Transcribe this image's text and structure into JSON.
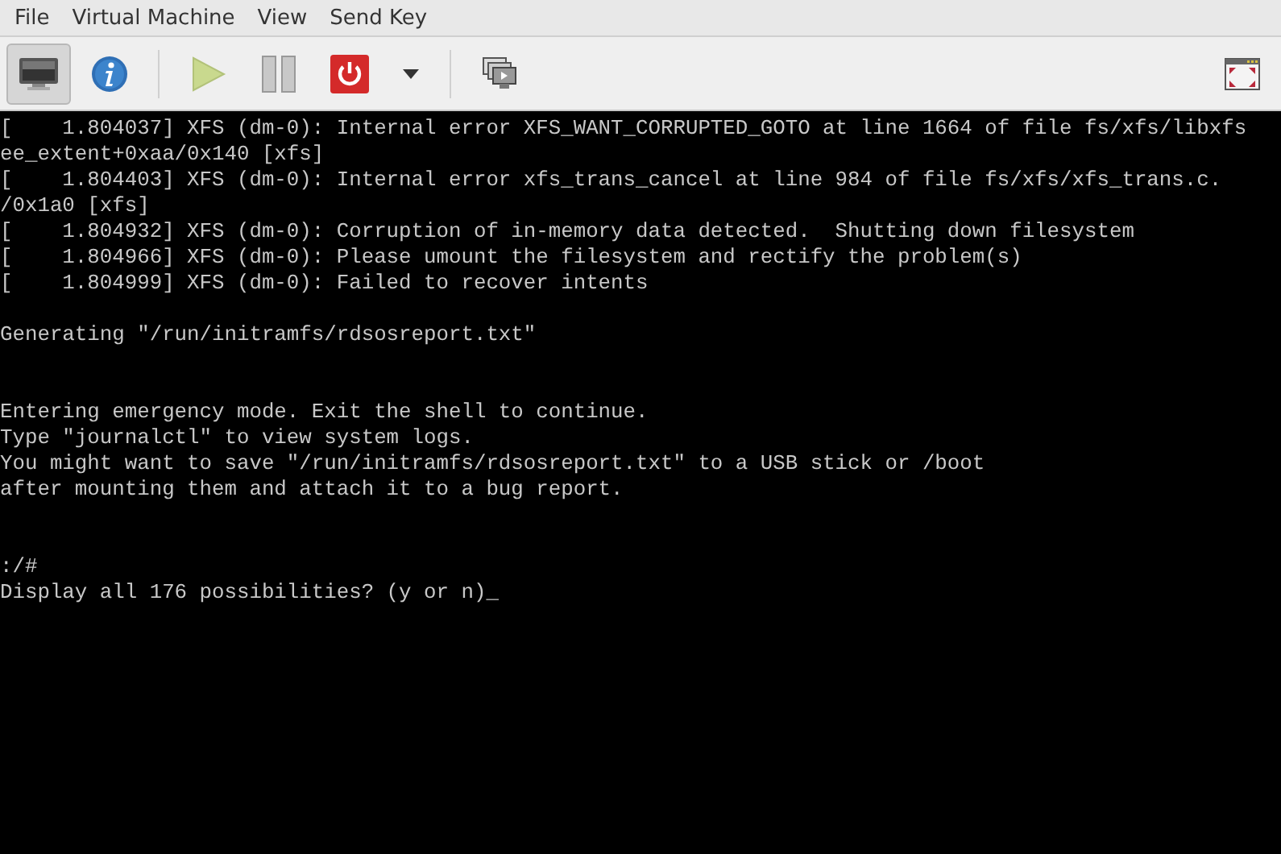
{
  "menu": [
    "File",
    "Virtual Machine",
    "View",
    "Send Key"
  ],
  "toolbar": [
    {
      "kind": "console",
      "selected": true
    },
    {
      "kind": "details",
      "selected": false
    },
    {
      "kind": "separator"
    },
    {
      "kind": "run",
      "selected": false
    },
    {
      "kind": "pause",
      "selected": false
    },
    {
      "kind": "shutdown",
      "selected": false
    },
    {
      "kind": "dropdown",
      "selected": false
    },
    {
      "kind": "separator"
    },
    {
      "kind": "screens",
      "selected": false
    },
    {
      "kind": "spacer"
    },
    {
      "kind": "fullscreen",
      "selected": false
    }
  ],
  "console": [
    {
      "kind": "text",
      "text": "[    1.804037] XFS (dm-0): Internal error XFS_WANT_CORRUPTED_GOTO at line 1664 of file fs/xfs/libxfs"
    },
    {
      "kind": "text",
      "text": "ee_extent+0xaa/0x140 [xfs]"
    },
    {
      "kind": "text",
      "text": "[    1.804403] XFS (dm-0): Internal error xfs_trans_cancel at line 984 of file fs/xfs/xfs_trans.c."
    },
    {
      "kind": "text",
      "text": "/0x1a0 [xfs]"
    },
    {
      "kind": "text",
      "text": "[    1.804932] XFS (dm-0): Corruption of in-memory data detected.  Shutting down filesystem"
    },
    {
      "kind": "text",
      "text": "[    1.804966] XFS (dm-0): Please umount the filesystem and rectify the problem(s)"
    },
    {
      "kind": "text",
      "text": "[    1.804999] XFS (dm-0): Failed to recover intents"
    },
    {
      "kind": "blank"
    },
    {
      "kind": "text",
      "text": "Generating \"/run/initramfs/rdsosreport.txt\""
    },
    {
      "kind": "blank"
    },
    {
      "kind": "blank"
    },
    {
      "kind": "text",
      "text": "Entering emergency mode. Exit the shell to continue."
    },
    {
      "kind": "text",
      "text": "Type \"journalctl\" to view system logs."
    },
    {
      "kind": "text",
      "text": "You might want to save \"/run/initramfs/rdsosreport.txt\" to a USB stick or /boot"
    },
    {
      "kind": "text",
      "text": "after mounting them and attach it to a bug report."
    },
    {
      "kind": "blank"
    },
    {
      "kind": "blank"
    },
    {
      "kind": "text",
      "text": ":/#"
    },
    {
      "kind": "text",
      "text": "Display all 176 possibilities? (y or n)_"
    }
  ]
}
